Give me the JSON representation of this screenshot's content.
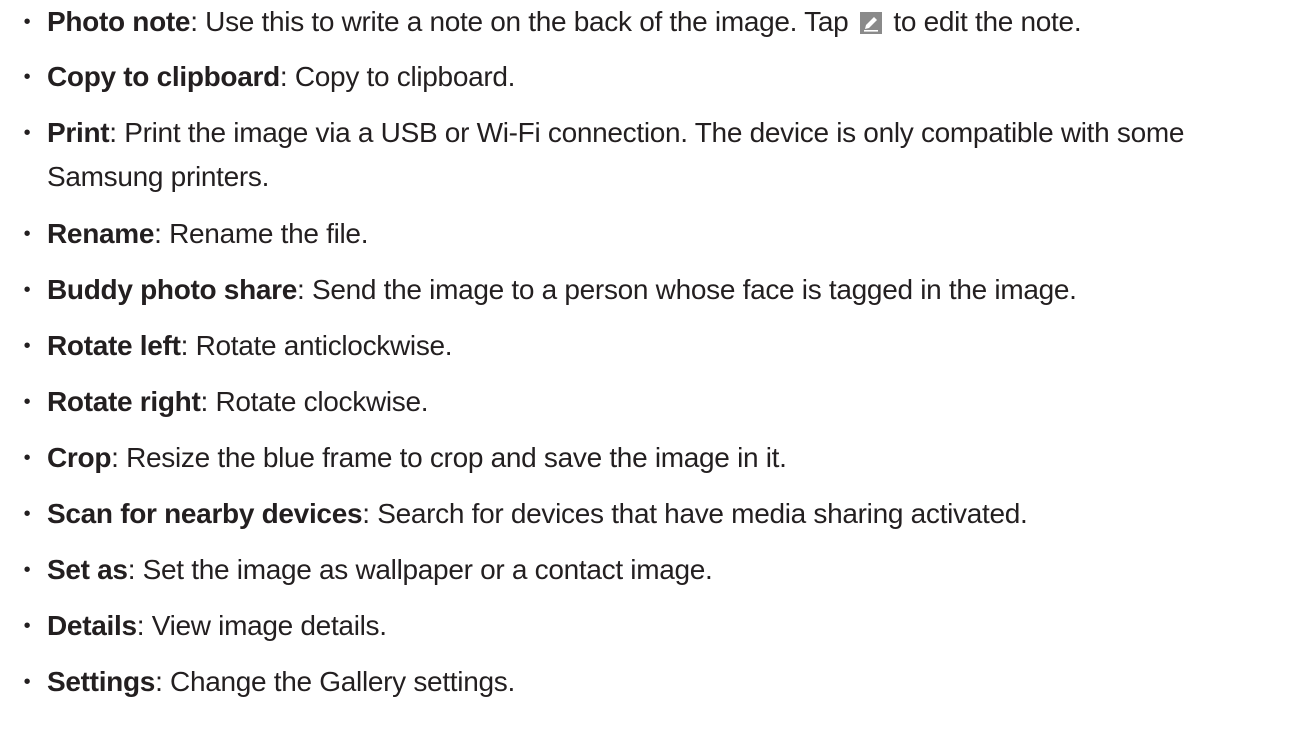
{
  "items": [
    {
      "term": "Photo note",
      "desc_before": ": Use this to write a note on the back of the image. Tap",
      "icon": "edit-pencil-icon",
      "desc_after": "to edit the note."
    },
    {
      "term": "Copy to clipboard",
      "desc": ": Copy to clipboard."
    },
    {
      "term": "Print",
      "desc": ": Print the image via a USB or Wi-Fi connection. The device is only compatible with some Samsung printers."
    },
    {
      "term": "Rename",
      "desc": ": Rename the file."
    },
    {
      "term": "Buddy photo share",
      "desc": ": Send the image to a person whose face is tagged in the image."
    },
    {
      "term": "Rotate left",
      "desc": ": Rotate anticlockwise."
    },
    {
      "term": "Rotate right",
      "desc": ": Rotate clockwise."
    },
    {
      "term": "Crop",
      "desc": ": Resize the blue frame to crop and save the image in it."
    },
    {
      "term": "Scan for nearby devices",
      "desc": ": Search for devices that have media sharing activated."
    },
    {
      "term": "Set as",
      "desc": ": Set the image as wallpaper or a contact image."
    },
    {
      "term": "Details",
      "desc": ": View image details."
    },
    {
      "term": "Settings",
      "desc": ": Change the Gallery settings."
    }
  ],
  "bullet": "•",
  "colors": {
    "text": "#231f20",
    "icon_bg": "#8a8a8a",
    "icon_fg": "#ffffff"
  }
}
